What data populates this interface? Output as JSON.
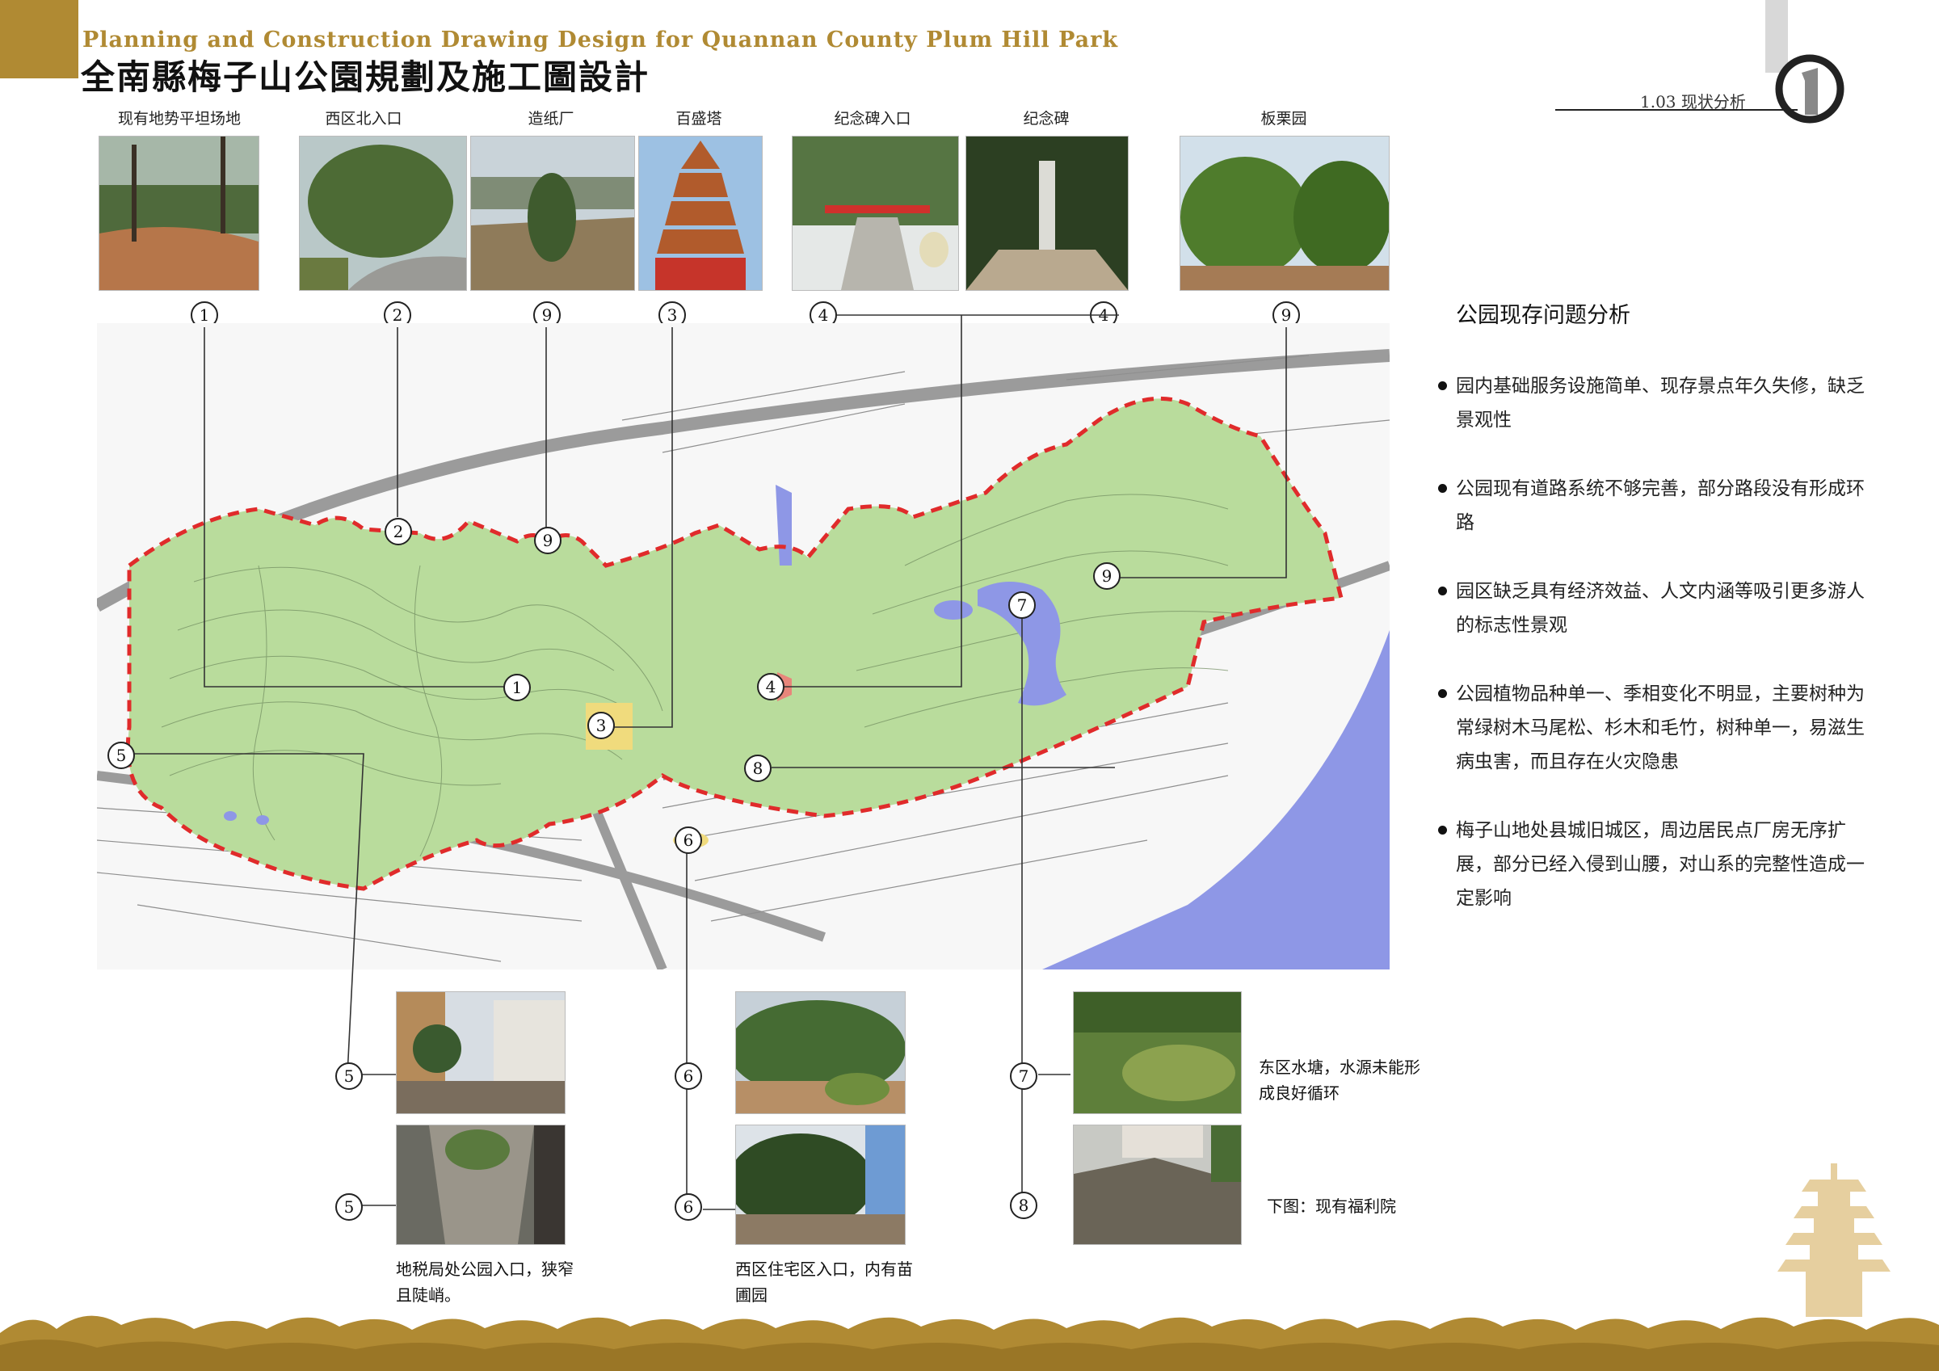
{
  "header": {
    "title_en": "Planning and Construction Drawing Design for Quannan County Plum Hill Park",
    "title_cn": "全南縣梅子山公園規劃及施工圖設計",
    "page_label": "1.03 现状分析"
  },
  "top_photos": [
    {
      "num": "1",
      "label": "现有地势平坦场地"
    },
    {
      "num": "2",
      "label": "西区北入口"
    },
    {
      "num": "9",
      "label": "造纸厂"
    },
    {
      "num": "3",
      "label": "百盛塔"
    },
    {
      "num": "4",
      "label": "纪念碑入口"
    },
    {
      "num": "4",
      "label": "纪念碑"
    },
    {
      "num": "9",
      "label": "板栗园"
    }
  ],
  "map_markers": [
    "1",
    "2",
    "3",
    "4",
    "5",
    "6",
    "7",
    "8",
    "9"
  ],
  "analysis": {
    "title": "公园现存问题分析",
    "items": [
      "园内基础服务设施简单、现存景点年久失修，缺乏景观性",
      "公园现有道路系统不够完善，部分路段没有形成环路",
      "园区缺乏具有经济效益、人文内涵等吸引更多游人的标志性景观",
      "公园植物品种单一、季相变化不明显，主要树种为常绿树木马尾松、杉木和毛竹，树种单一，易滋生病虫害，而且存在火灾隐患",
      "梅子山地处县城旧城区，周边居民点厂房无序扩展，部分已经入侵到山腰，对山系的完整性造成一定影响"
    ]
  },
  "bottom_groups": [
    {
      "num_a": "5",
      "num_b": "5",
      "caption": "地税局处公园入口，狭窄且陡峭。"
    },
    {
      "num_a": "6",
      "num_b": "6",
      "caption": "西区住宅区入口，内有苗圃园"
    },
    {
      "num_a": "7",
      "num_b": "8",
      "caption_a": "东区水塘，水源未能形成良好循环",
      "caption_b": "下图：现有福利院"
    }
  ],
  "colors": {
    "brand_gold": "#b08a33",
    "park_green": "#b9dc9c",
    "water_blue": "#8e97e6",
    "boundary_red": "#e02b2b"
  }
}
